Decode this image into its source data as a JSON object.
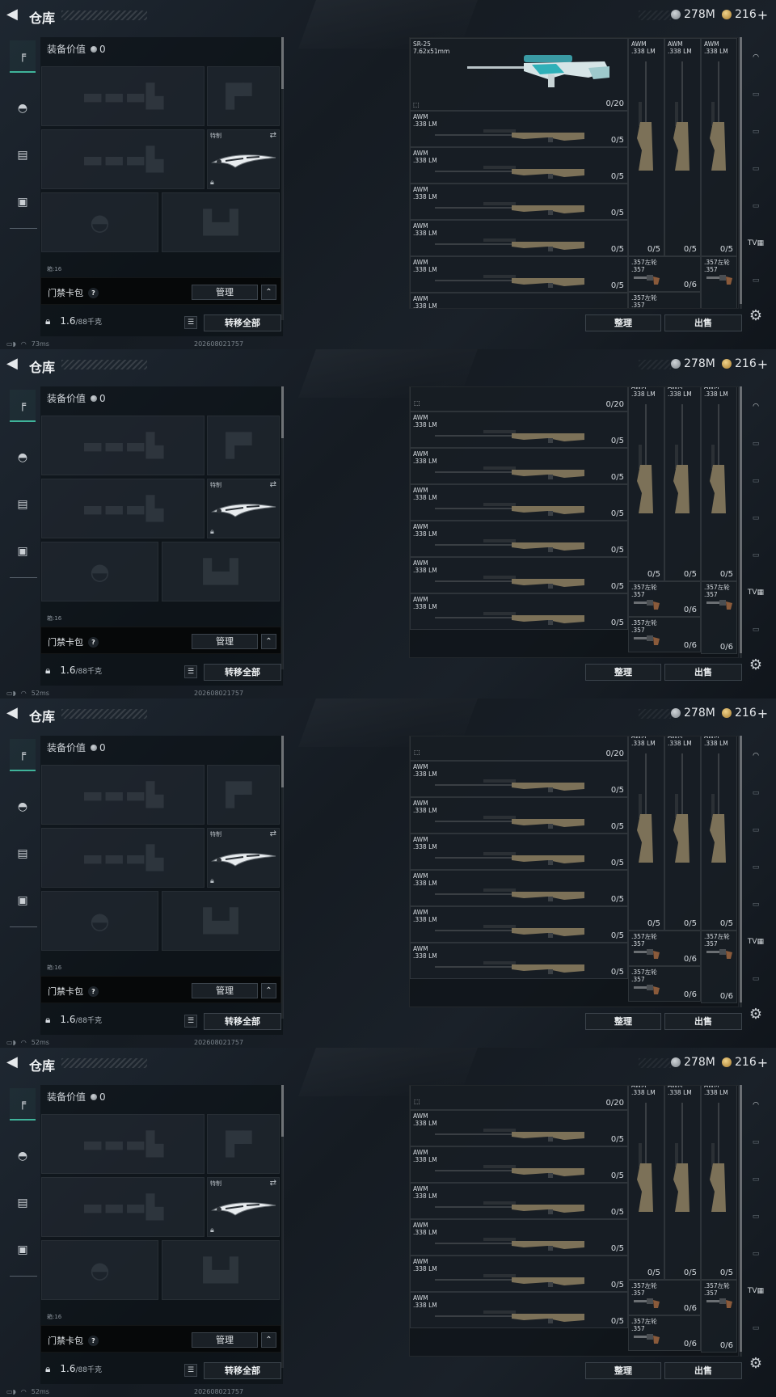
{
  "frames": [
    {
      "id": "frame-1",
      "scroll": 0,
      "ping": "73ms"
    },
    {
      "id": "frame-2",
      "scroll": 1,
      "ping": "52ms"
    },
    {
      "id": "frame-3",
      "scroll": 1,
      "ping": "52ms"
    },
    {
      "id": "frame-4",
      "scroll": 1,
      "ping": "52ms"
    }
  ],
  "header": {
    "back_icon": "back-arrow-icon",
    "title": "仓库",
    "currency": [
      {
        "icon": "silver-coin-icon",
        "value": "278M",
        "color": "#b8bec4"
      },
      {
        "icon": "gold-coin-icon",
        "value": "216",
        "color": "#d3a44a",
        "plus": "+"
      }
    ]
  },
  "left_nav": {
    "items": [
      {
        "icon": "pistol-icon",
        "active": true
      },
      {
        "icon": "helmet-icon",
        "active": false
      },
      {
        "icon": "clipboard-icon",
        "active": false
      },
      {
        "icon": "briefcase-icon",
        "active": false
      }
    ]
  },
  "equipment": {
    "value_label": "装备价值",
    "value": "0",
    "knife_label": "特制",
    "card_pack_label": "门禁卡包",
    "help": "?",
    "manage_label": "管理",
    "collapse_icon": "chevron-up-icon",
    "weight_value": "1.6",
    "weight_max": "/88千克",
    "transfer_label": "转移全部",
    "capacity_text": "箱:16"
  },
  "status": {
    "timestamp": "202608021757"
  },
  "stash": {
    "sr25": {
      "name": "SR-25\n7.62x51mm",
      "count": "0/20"
    },
    "slot_count": "0/20",
    "awm_name": "AWM\n.338 LM",
    "awm_count": "0/5",
    "rev_name": ".357左轮\n.357",
    "rev_count": "0/6",
    "sort_label": "整理",
    "sell_label": "出售"
  },
  "right_nav": {
    "items": [
      "hood-icon",
      "tv-icon",
      "tv-add-icon",
      "tv-icon",
      "tv-icon",
      "tv-main-icon",
      "tv-icon"
    ]
  },
  "accent": "#3fb39a"
}
